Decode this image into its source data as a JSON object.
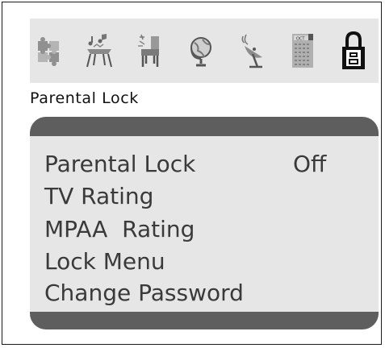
{
  "header": {
    "title": "Parental Lock"
  },
  "icons": [
    {
      "name": "puzzle-icon",
      "selected": false
    },
    {
      "name": "music-table-icon",
      "selected": false
    },
    {
      "name": "chair-icon",
      "selected": false
    },
    {
      "name": "globe-icon",
      "selected": false
    },
    {
      "name": "satellite-dish-icon",
      "selected": false
    },
    {
      "name": "calendar-icon",
      "selected": false,
      "label": "OCT"
    },
    {
      "name": "padlock-icon",
      "selected": true
    }
  ],
  "menu": {
    "items": [
      {
        "label": "Parental Lock",
        "value": "Off"
      },
      {
        "label": "TV Rating"
      },
      {
        "label": "MPAA  Rating"
      },
      {
        "label": "Lock Menu"
      },
      {
        "label": "Change Password"
      }
    ]
  }
}
